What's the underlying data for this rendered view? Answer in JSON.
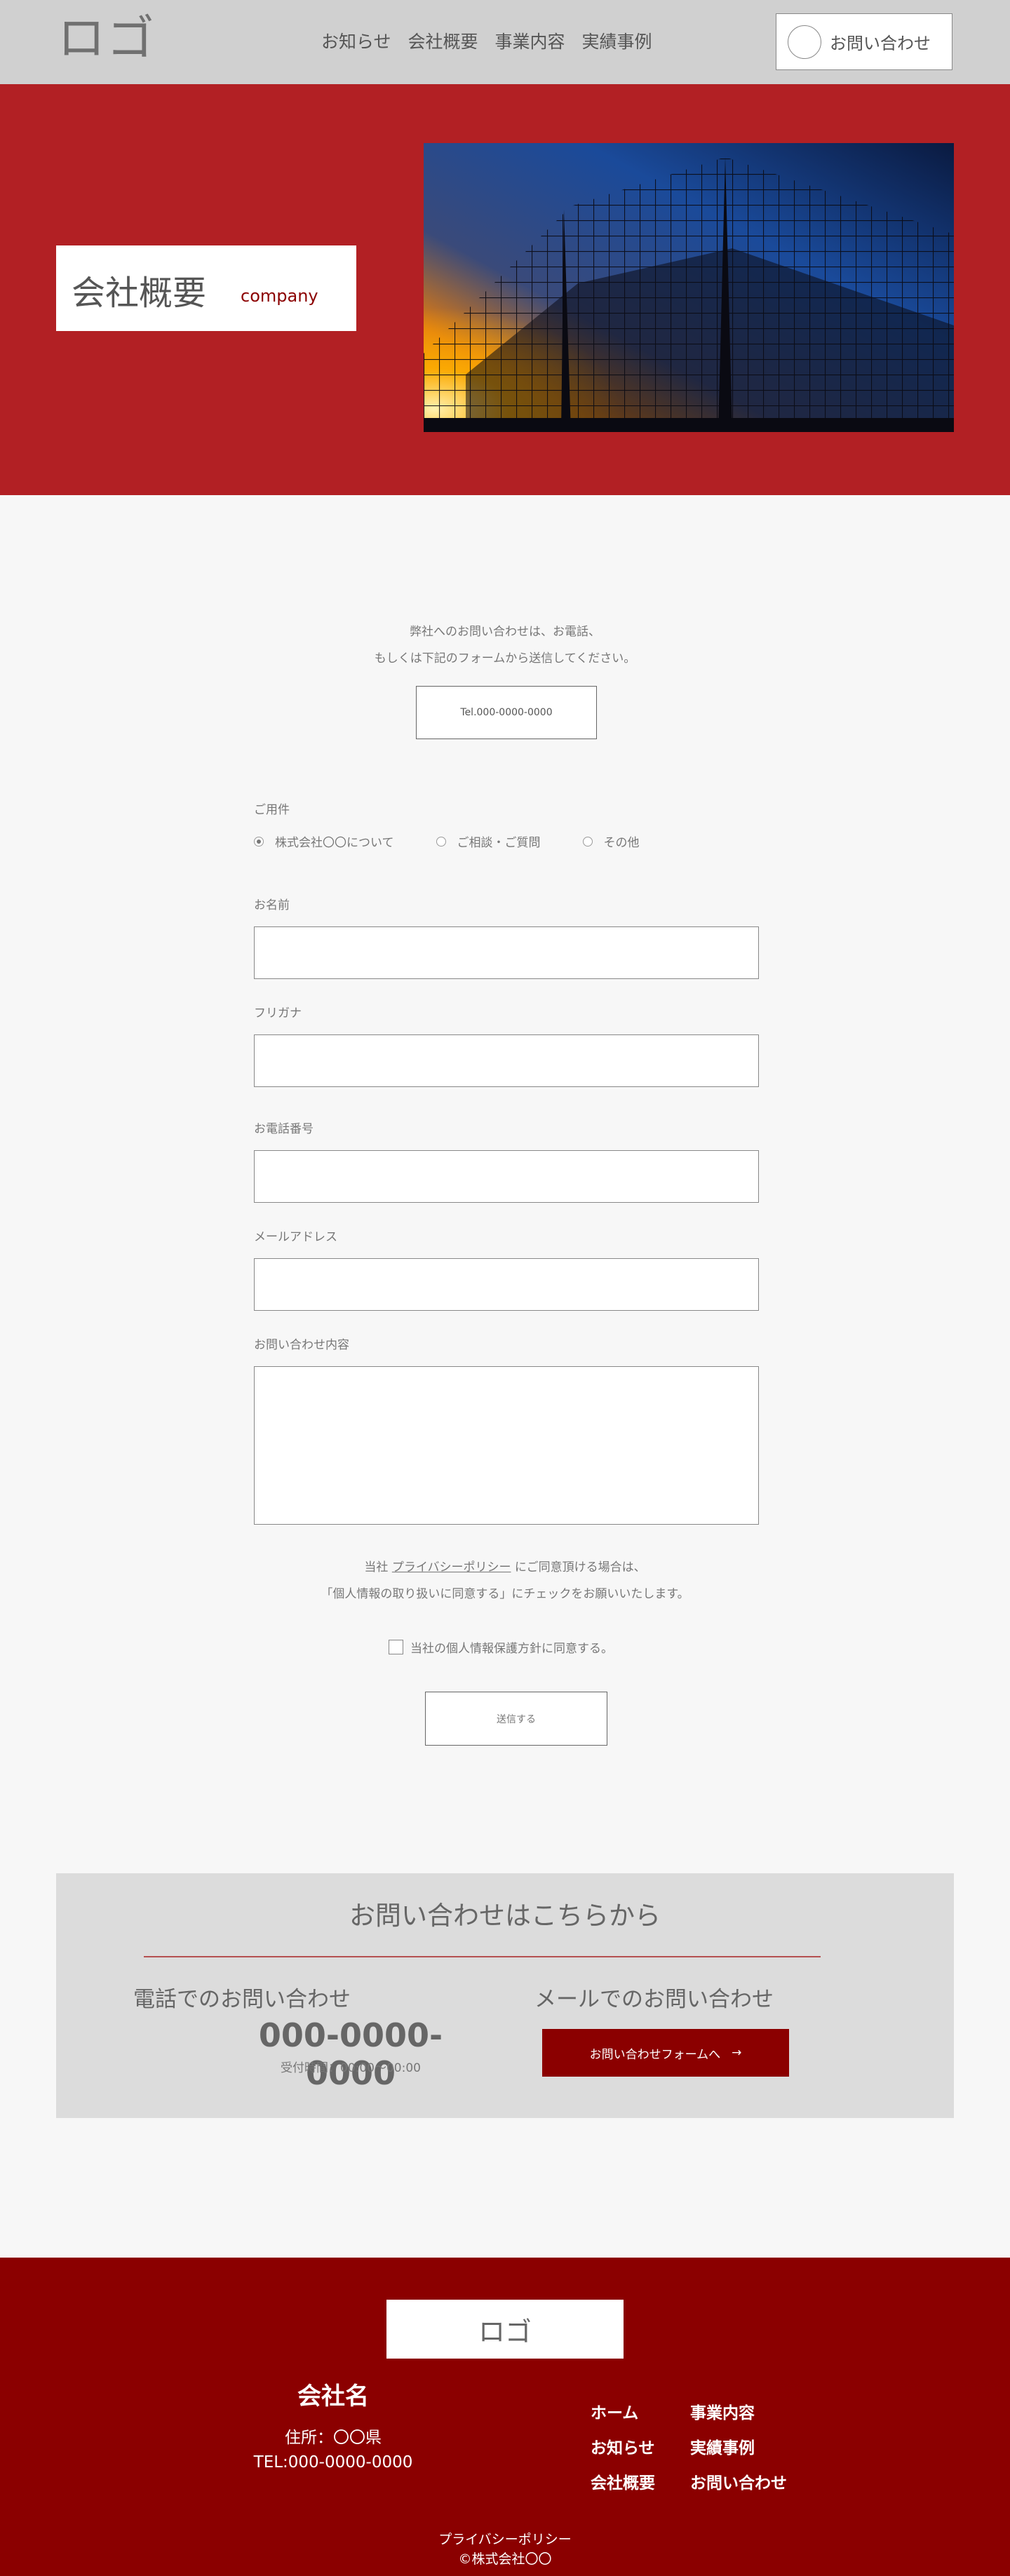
{
  "header": {
    "logo": "ロゴ",
    "nav": [
      "お知らせ",
      "会社概要",
      "事業内容",
      "実績事例"
    ],
    "contact_label": "お問い合わせ"
  },
  "hero": {
    "title": "会社概要",
    "subtitle": "company"
  },
  "intro": {
    "line1": "弊社へのお問い合わせは、お電話、",
    "line2": "もしくは下記のフォームから送信してください。",
    "tel": "Tel.000-0000-0000"
  },
  "form": {
    "purpose_label": "ご用件",
    "purpose_options": [
      "株式会社〇〇について",
      "ご相談・ご質問",
      "その他"
    ],
    "purpose_selected": "株式会社〇〇について",
    "name_label": "お名前",
    "kana_label": "フリガナ",
    "phone_label": "お電話番号",
    "email_label": "メールアドレス",
    "message_label": "お問い合わせ内容",
    "privacy_pre": "当社",
    "privacy_link": "プライバシーポリシー",
    "privacy_post": "にご同意頂ける場合は、",
    "privacy_line2": "「個人情報の取り扱いに同意する」にチェックをお願いいたします。",
    "agree_label": "当社の個人情報保護方針に同意する。",
    "agree_checked": false,
    "submit_label": "送信する"
  },
  "cta": {
    "title": "お問い合わせはこちらから",
    "tel_heading": "電話でのお問い合わせ",
    "tel_number": "000-0000-0000",
    "hours": "受付時間：00:00〜00:00",
    "mail_heading": "メールでのお問い合わせ",
    "mail_button": "お問い合わせフォームへ",
    "mail_button_arrow": "→"
  },
  "footer": {
    "logo": "ロゴ",
    "company": "会社名",
    "address": "住所：〇〇県",
    "tel": "TEL:000-0000-0000",
    "links": [
      "ホーム",
      "事業内容",
      "お知らせ",
      "実績事例",
      "会社概要",
      "お問い合わせ"
    ],
    "privacy": "プライバシーポリシー",
    "copyright": "©株式会社〇〇"
  },
  "colors": {
    "header_bg": "#d0d0d0",
    "hero_bg": "#b22024",
    "accent": "#8b0000",
    "page_bg": "#f7f7f7",
    "cta_bg": "#dcdcdc"
  }
}
